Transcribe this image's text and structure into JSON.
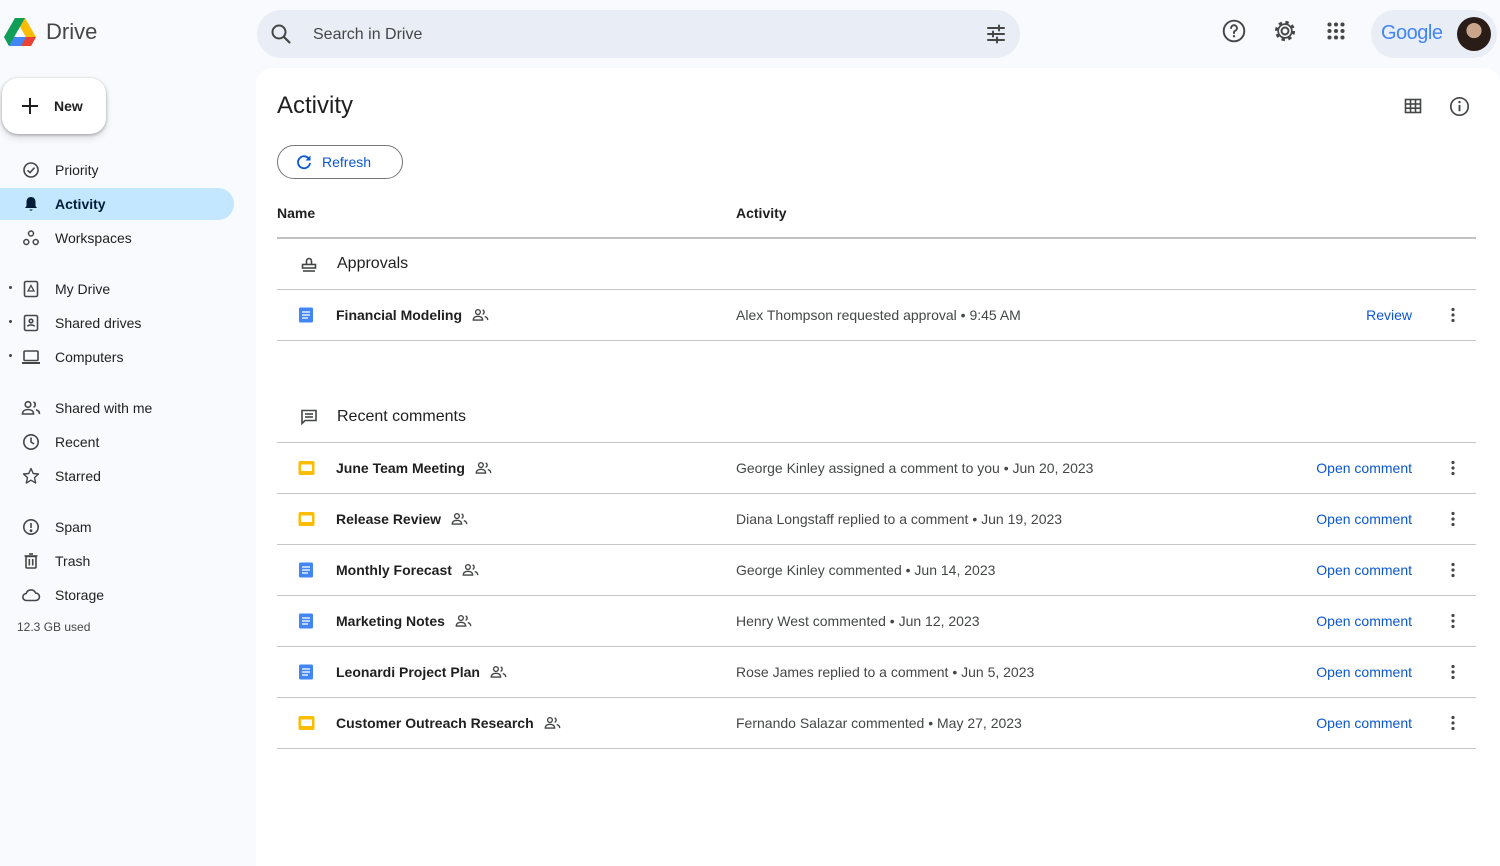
{
  "app": {
    "name": "Drive",
    "google_word": "Google"
  },
  "search": {
    "placeholder": "Search in Drive"
  },
  "sidebar": {
    "new_label": "New",
    "items": [
      {
        "label": "Priority",
        "icon": "priority-icon"
      },
      {
        "label": "Activity",
        "icon": "bell-icon",
        "active": true
      },
      {
        "label": "Workspaces",
        "icon": "workspaces-icon"
      },
      {
        "label": "My Drive",
        "icon": "my-drive-icon"
      },
      {
        "label": "Shared drives",
        "icon": "shared-drives-icon"
      },
      {
        "label": "Computers",
        "icon": "computer-icon"
      },
      {
        "label": "Shared with me",
        "icon": "people-icon"
      },
      {
        "label": "Recent",
        "icon": "clock-icon"
      },
      {
        "label": "Starred",
        "icon": "star-icon"
      },
      {
        "label": "Spam",
        "icon": "spam-icon"
      },
      {
        "label": "Trash",
        "icon": "trash-icon"
      },
      {
        "label": "Storage",
        "icon": "cloud-icon"
      }
    ],
    "storage_used": "12.3 GB used"
  },
  "main": {
    "title": "Activity",
    "refresh_label": "Refresh",
    "columns": {
      "name": "Name",
      "activity": "Activity"
    },
    "approvals": {
      "label": "Approvals",
      "rows": [
        {
          "name": "Financial Modeling",
          "type": "doc",
          "activity": "Alex Thompson requested approval • 9:45 AM",
          "action": "Review"
        }
      ]
    },
    "comments": {
      "label": "Recent comments",
      "rows": [
        {
          "name": "June Team Meeting",
          "type": "slides",
          "activity": "George Kinley assigned a comment to you • Jun 20, 2023",
          "action": "Open comment"
        },
        {
          "name": "Release Review",
          "type": "slides",
          "activity": "Diana Longstaff replied to a comment • Jun 19, 2023",
          "action": "Open comment"
        },
        {
          "name": "Monthly Forecast",
          "type": "doc",
          "activity": "George Kinley commented • Jun 14, 2023",
          "action": "Open comment"
        },
        {
          "name": "Marketing Notes",
          "type": "doc",
          "activity": "Henry West commented • Jun 12, 2023",
          "action": "Open comment"
        },
        {
          "name": "Leonardi Project Plan",
          "type": "doc",
          "activity": "Rose James replied to a comment • Jun 5, 2023",
          "action": "Open comment"
        },
        {
          "name": "Customer Outreach Research",
          "type": "slides",
          "activity": "Fernando Salazar commented • May 27, 2023",
          "action": "Open comment"
        }
      ]
    }
  },
  "colors": {
    "doc": "#4285f4",
    "slides": "#fbbc04",
    "link": "#0b57d0",
    "active_nav": "#c2e7ff"
  }
}
